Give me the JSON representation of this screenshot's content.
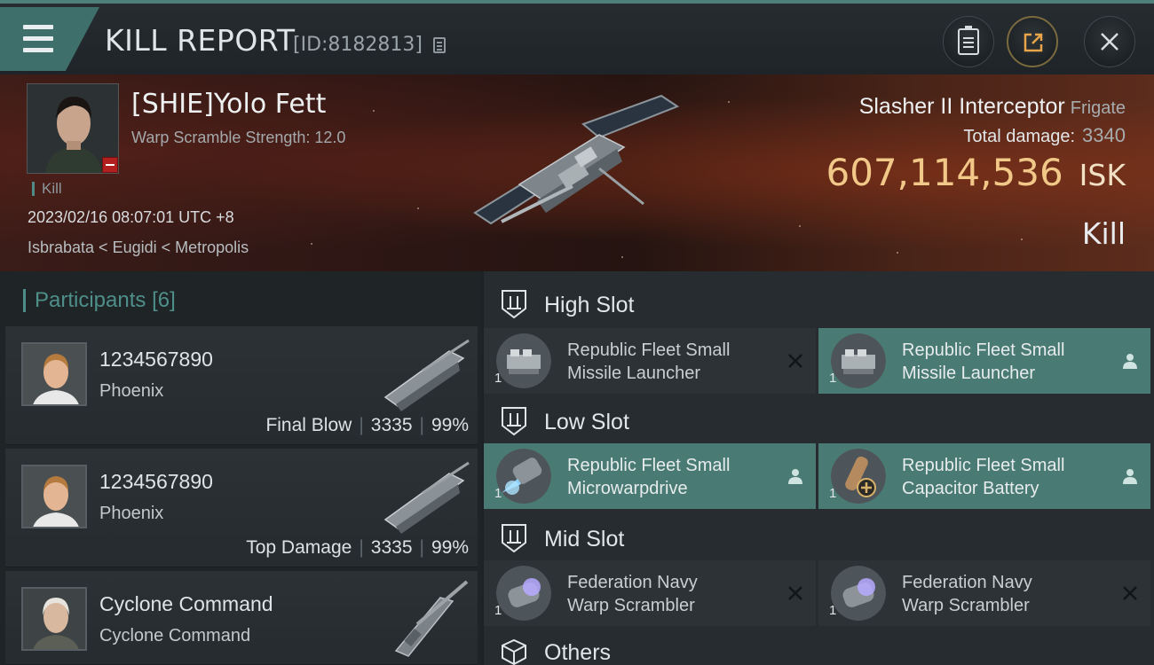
{
  "header": {
    "title": "KILL REPORT",
    "report_id": "[ID:8182813]",
    "icons": {
      "menu": "hamburger-icon",
      "copy": "copy-icon",
      "clipboard": "clipboard-icon",
      "share": "share-icon",
      "close": "close-icon"
    }
  },
  "victim": {
    "name": "[SHIE]Yolo Fett",
    "warp_scramble": "Warp Scramble Strength: 12.0",
    "tag": "Kill",
    "time": "2023/02/16 08:07:01 UTC +8",
    "location": "Isbrabata < Eugidi < Metropolis",
    "ship_name": "Slasher II Interceptor",
    "ship_class": "Frigate",
    "total_damage_label": "Total damage:",
    "total_damage": "3340",
    "isk_value": "607,114,536",
    "isk_unit": "ISK",
    "result": "Kill"
  },
  "participants": {
    "header": "Participants",
    "count": "[6]",
    "rows": [
      {
        "name": "1234567890",
        "ship": "Phoenix",
        "role": "Final Blow",
        "damage": "3335",
        "percent": "99%"
      },
      {
        "name": "1234567890",
        "ship": "Phoenix",
        "role": "Top Damage",
        "damage": "3335",
        "percent": "99%"
      },
      {
        "name": "Cyclone Command",
        "ship": "Cyclone Command",
        "role": "",
        "damage": "",
        "percent": ""
      }
    ]
  },
  "fitting": {
    "high_slot": {
      "label": "High Slot",
      "items": [
        {
          "line1": "Republic Fleet Small",
          "line2": "Missile Launcher",
          "qty": "1",
          "status": "destroyed-x-icon",
          "active": false
        },
        {
          "line1": "Republic Fleet Small",
          "line2": "Missile Launcher",
          "qty": "1",
          "status": "person-icon",
          "active": true
        }
      ]
    },
    "low_slot": {
      "label": "Low Slot",
      "items": [
        {
          "line1": "Republic Fleet Small",
          "line2": "Microwarpdrive",
          "qty": "1",
          "status": "person-icon",
          "active": true
        },
        {
          "line1": "Republic Fleet Small",
          "line2": "Capacitor Battery",
          "qty": "1",
          "status": "person-icon",
          "active": true
        }
      ]
    },
    "mid_slot": {
      "label": "Mid Slot",
      "items": [
        {
          "line1": "Federation Navy",
          "line2": "Warp Scrambler",
          "qty": "1",
          "status": "destroyed-x-icon",
          "active": false
        },
        {
          "line1": "Federation Navy",
          "line2": "Warp Scrambler",
          "qty": "1",
          "status": "destroyed-x-icon",
          "active": false
        }
      ]
    },
    "others": {
      "label": "Others"
    }
  },
  "colors": {
    "accent_teal": "#4e8f8a",
    "active_item": "#4a7a74",
    "isk_gold": "#f1c888",
    "badge_red": "#b21f1f"
  }
}
